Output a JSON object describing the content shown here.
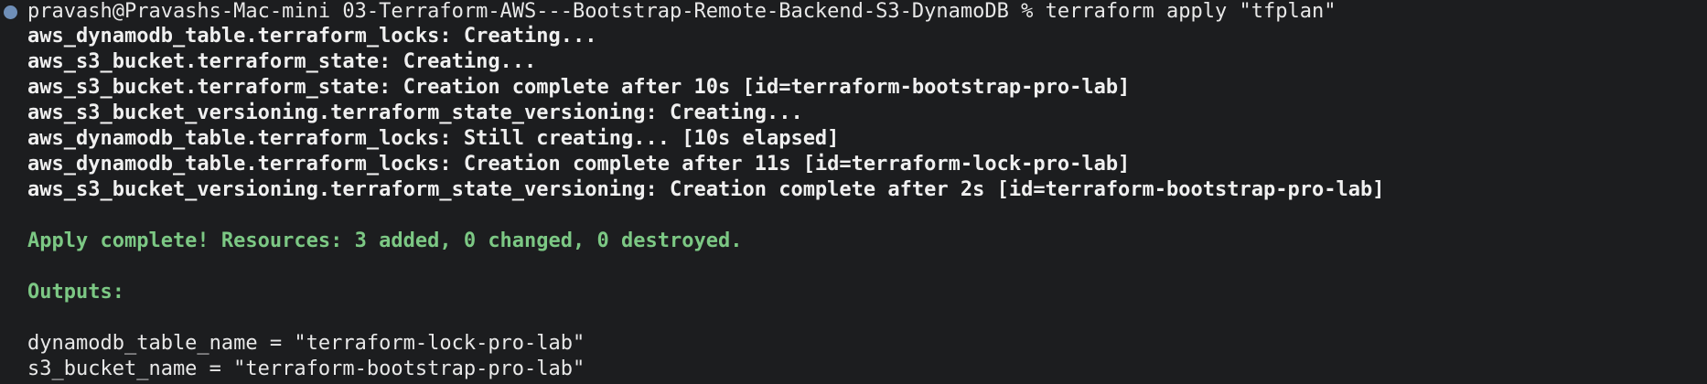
{
  "terminal": {
    "prompt": "pravash@Pravashs-Mac-mini 03-Terraform-AWS---Bootstrap-Remote-Backend-S3-DynamoDB % terraform apply \"tfplan\"",
    "log_lines": [
      "aws_dynamodb_table.terraform_locks: Creating...",
      "aws_s3_bucket.terraform_state: Creating...",
      "aws_s3_bucket.terraform_state: Creation complete after 10s [id=terraform-bootstrap-pro-lab]",
      "aws_s3_bucket_versioning.terraform_state_versioning: Creating...",
      "aws_dynamodb_table.terraform_locks: Still creating... [10s elapsed]",
      "aws_dynamodb_table.terraform_locks: Creation complete after 11s [id=terraform-lock-pro-lab]",
      "aws_s3_bucket_versioning.terraform_state_versioning: Creation complete after 2s [id=terraform-bootstrap-pro-lab]"
    ],
    "apply_summary": "Apply complete! Resources: 3 added, 0 changed, 0 destroyed.",
    "outputs_header": "Outputs:",
    "outputs": [
      "dynamodb_table_name = \"terraform-lock-pro-lab\"",
      "s3_bucket_name = \"terraform-bootstrap-pro-lab\""
    ],
    "colors": {
      "background": "#1c1d1f",
      "success_green": "#7cc884",
      "prompt_dot": "#6f8fb8"
    }
  }
}
